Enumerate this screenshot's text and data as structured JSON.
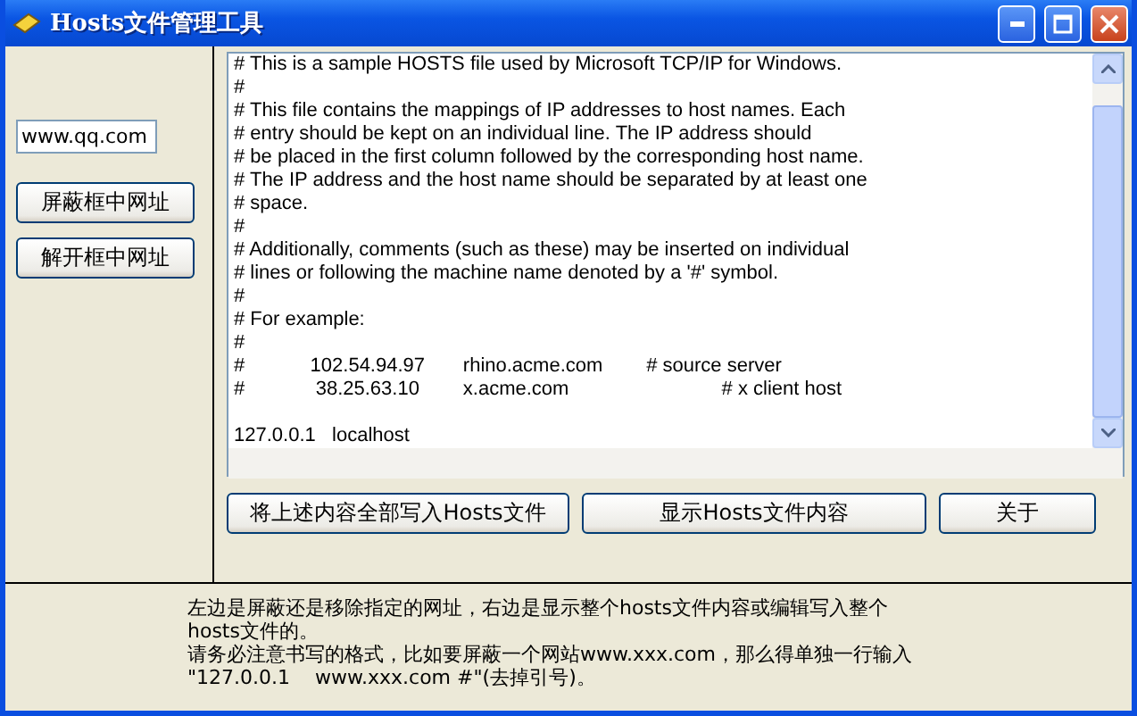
{
  "window": {
    "title": "Hosts文件管理工具"
  },
  "url_field": {
    "value": "www.qq.com"
  },
  "side_buttons": [
    "屏蔽框中网址",
    "解开框中网址"
  ],
  "hosts_blocks": [
    [
      "# This is a sample HOSTS file used by Microsoft TCP/IP for Windows.",
      "#",
      "# This file contains the mappings of IP addresses to host names. Each",
      "# entry should be kept on an individual line. The IP address should",
      "# be placed in the first column followed by the corresponding host name.",
      "# The IP address and the host name should be separated by at least one",
      "# space.",
      "#",
      "# Additionally, comments (such as these) may be inserted on individual",
      "# lines or following the machine name denoted by a '#' symbol.",
      "#",
      "# For example:",
      "#",
      "#            102.54.94.97       rhino.acme.com        # source server",
      "#             38.25.63.10        x.acme.com                            # x client host"
    ],
    [
      "127.0.0.1   localhost"
    ]
  ],
  "bottom_buttons": [
    "将上述内容全部写入Hosts文件",
    "显示Hosts文件内容",
    "关于"
  ],
  "help_lines": [
    "左边是屏蔽还是移除指定的网址，右边是显示整个hosts文件内容或编辑写入整个",
    "hosts文件的。",
    "请务必注意书写的格式，比如要屏蔽一个网站www.xxx.com，那么得单独一行输入",
    "\"127.0.0.1    www.xxx.com #\"(去掉引号)。"
  ]
}
